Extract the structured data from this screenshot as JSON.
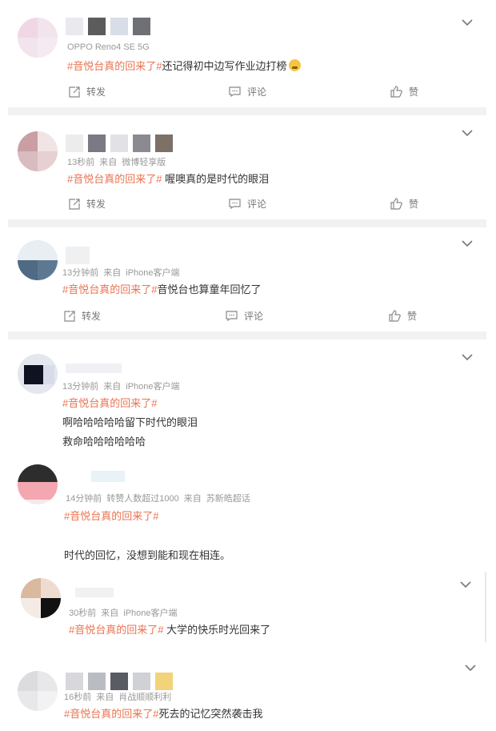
{
  "actions": {
    "repost": "转发",
    "comment": "评论",
    "like": "赞"
  },
  "comments": [
    {
      "meta": [
        "OPPO Reno4 SE 5G"
      ],
      "topic": "#音悦台真的回来了#",
      "text": "还记得初中边写作业边打榜",
      "emoji": "crying-face-icon"
    },
    {
      "meta": [
        "13秒前",
        "来自",
        "微博轻享版"
      ],
      "topic": "#音悦台真的回来了#",
      "text": " 喔噢真的是时代的眼泪"
    },
    {
      "meta": [
        "13分钟前",
        "来自",
        "iPhone客户端"
      ],
      "topic": "#音悦台真的回来了#",
      "text": "音悦台也算童年回忆了"
    },
    {
      "meta": [
        "13分钟前",
        "来自",
        "iPhone客户端"
      ],
      "topic": "#音悦台真的回来了#",
      "lines": [
        "啊哈哈哈哈哈留下时代的眼泪",
        "救命哈哈哈哈哈哈"
      ]
    },
    {
      "meta": [
        "14分钟前",
        "转赞人数超过1000",
        "来自",
        "苏新皓超话"
      ],
      "topic": "#音悦台真的回来了#",
      "lines": [
        "时代的回忆，没想到能和现在相连。"
      ]
    },
    {
      "meta": [
        "30秒前",
        "来自",
        "iPhone客户端"
      ],
      "topic": "#音悦台真的回来了#",
      "text": " 大学的快乐时光回来了"
    },
    {
      "meta": [
        "16秒前",
        "来自",
        "肖战顺顺利利"
      ],
      "topic": "#音悦台真的回来了#",
      "text": "死去的记忆突然袭击我"
    }
  ]
}
